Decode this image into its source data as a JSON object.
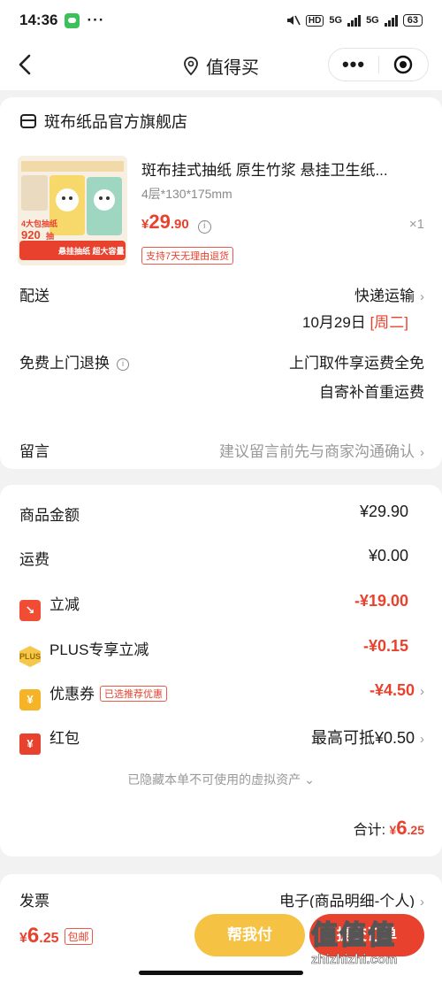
{
  "status_bar": {
    "time": "14:36",
    "dots": "···",
    "hd": "HD",
    "net1": "5G",
    "net2": "5G",
    "battery": "63"
  },
  "nav": {
    "title": "值得买"
  },
  "store": {
    "name": "斑布纸品官方旗舰店",
    "product": {
      "title": "斑布挂式抽纸 原生竹浆 悬挂卫生纸...",
      "spec": "4层*130*175mm",
      "price_currency": "¥",
      "price_int": "29",
      "price_dec": ".90",
      "info_icon": "i",
      "qty": "×1",
      "return_tag": "支持7天无理由退货",
      "thumb_texts": {
        "count": "920",
        "unit": "抽",
        "label": "4大包抽纸",
        "band": "悬挂抽纸 超大容量"
      }
    },
    "delivery": {
      "label": "配送",
      "method": "快递运输",
      "date": "10月29日",
      "weekday": "[周二]"
    },
    "free_return": {
      "label": "免费上门退换",
      "line1": "上门取件享运费全免",
      "line2": "自寄补首重运费"
    },
    "message": {
      "label": "留言",
      "placeholder": "建议留言前先与商家沟通确认"
    }
  },
  "price": {
    "goods": {
      "label": "商品金额",
      "value": "¥29.90"
    },
    "shipping": {
      "label": "运费",
      "value": "¥0.00"
    },
    "discount": {
      "label": "立减",
      "value": "-¥19.00"
    },
    "plus": {
      "label": "PLUS专享立减",
      "value": "-¥0.15",
      "icon_text": "PLUS"
    },
    "coupon": {
      "label": "优惠券",
      "tag": "已选推荐优惠",
      "value": "-¥4.50",
      "icon_text": "¥"
    },
    "redpacket": {
      "label": "红包",
      "value": "最高可抵¥0.50",
      "icon_text": "¥"
    },
    "hidden_note": "已隐藏本单不可使用的虚拟资产",
    "total_label": "合计:",
    "total_currency": "¥",
    "total_int": "6",
    "total_dec": ".25"
  },
  "invoice": {
    "label": "发票",
    "value": "电子(商品明细-个人)"
  },
  "bottom": {
    "currency": "¥",
    "int": "6",
    "dec": ".25",
    "tag": "包邮",
    "help_pay": "帮我付",
    "pay": "提交订单"
  },
  "watermark": {
    "logo": "值值值",
    "url": "zhizhizhi.com"
  },
  "colors": {
    "accent": "#e8422e",
    "help_button": "#f6c244",
    "background": "#f2f2f2"
  }
}
